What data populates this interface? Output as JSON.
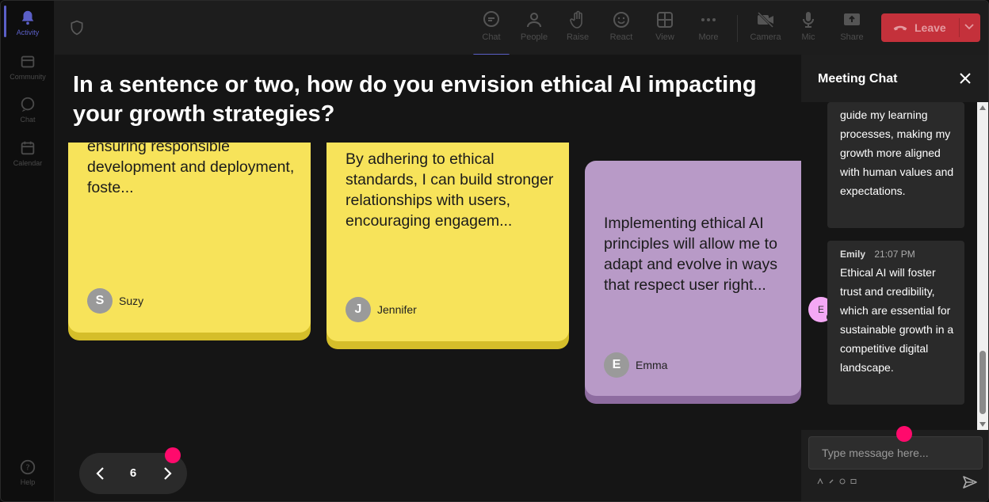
{
  "rail": {
    "items": [
      {
        "label": "Activity",
        "icon": "bell-icon"
      },
      {
        "label": "Community",
        "icon": "community-icon"
      },
      {
        "label": "Chat",
        "icon": "chat-icon"
      },
      {
        "label": "Calendar",
        "icon": "calendar-icon"
      }
    ],
    "help": {
      "label": "Help",
      "icon": "help-icon"
    }
  },
  "toolbar": {
    "buttons": [
      {
        "label": "Chat",
        "icon": "chat-icon"
      },
      {
        "label": "People",
        "icon": "people-icon"
      },
      {
        "label": "Raise",
        "icon": "raise-hand-icon"
      },
      {
        "label": "React",
        "icon": "react-icon"
      },
      {
        "label": "View",
        "icon": "view-grid-icon"
      },
      {
        "label": "More",
        "icon": "more-icon"
      },
      {
        "label": "Camera",
        "icon": "camera-off-icon"
      },
      {
        "label": "Mic",
        "icon": "mic-icon"
      },
      {
        "label": "Share",
        "icon": "share-icon"
      }
    ],
    "leave_label": "Leave",
    "leave_color": "#c4313b",
    "accent_color": "#5b5fc7"
  },
  "stage": {
    "question": "In a sentence or two, how do you envision ethical AI impacting your growth strategies?",
    "cards": [
      {
        "text": "ensuring responsible development and deployment, foste...",
        "author_initial": "S",
        "author": "Suzy",
        "color": "#f7e35a"
      },
      {
        "text": "By adhering to ethical standards, I can build stronger relationships with users, encouraging engagem...",
        "author_initial": "J",
        "author": "Jennifer",
        "color": "#f7e35a"
      },
      {
        "text": "Implementing ethical AI principles will allow me to adapt and evolve in ways that respect user right...",
        "author_initial": "E",
        "author": "Emma",
        "color": "#b89ac7"
      }
    ],
    "pager": {
      "page": "6"
    }
  },
  "chat": {
    "title": "Meeting Chat",
    "messages": [
      {
        "text": "guide my learning processes, making my growth more aligned with human values and expectations."
      },
      {
        "sender": "Emily",
        "time": "21:07 PM",
        "initial": "E",
        "text": "Ethical AI will foster trust and credibility, which are essential for sustainable growth in a competitive digital landscape."
      }
    ],
    "input_placeholder": "Type message here..."
  }
}
